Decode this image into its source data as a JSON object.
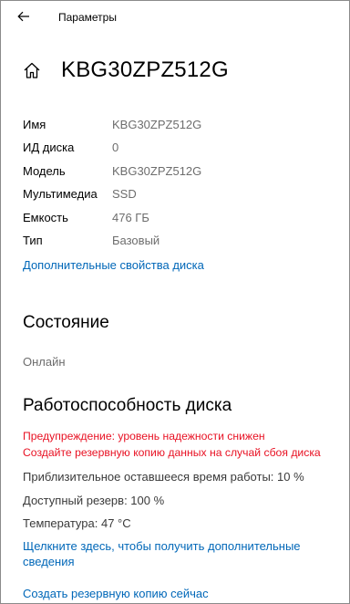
{
  "window": {
    "title": "Параметры"
  },
  "page": {
    "title": "KBG30ZPZ512G"
  },
  "properties": [
    {
      "label": "Имя",
      "value": "KBG30ZPZ512G"
    },
    {
      "label": "ИД диска",
      "value": "0"
    },
    {
      "label": "Модель",
      "value": "KBG30ZPZ512G"
    },
    {
      "label": "Мультимедиа",
      "value": "SSD"
    },
    {
      "label": "Емкость",
      "value": "476 ГБ"
    },
    {
      "label": "Тип",
      "value": "Базовый"
    }
  ],
  "links": {
    "advanced_properties": "Дополнительные свойства диска",
    "more_info": "Щелкните здесь, чтобы получить дополнительные сведения",
    "backup_now": "Создать резервную копию сейчас"
  },
  "status": {
    "title": "Состояние",
    "value": "Онлайн"
  },
  "health": {
    "title": "Работоспособность диска",
    "warnings": [
      "Предупреждение: уровень надежности снижен",
      "Создайте резервную копию данных на случай сбоя диска"
    ],
    "remaining_life": "Приблизительное оставшееся время работы: 10 %",
    "available_spare": "Доступный резерв: 100 %",
    "temperature": "Температура: 47 °C"
  },
  "colors": {
    "link": "#0067b8",
    "warning": "#e81123",
    "secondary_text": "#6d6d6d"
  },
  "icons": [
    "back-arrow-icon",
    "home-icon"
  ]
}
